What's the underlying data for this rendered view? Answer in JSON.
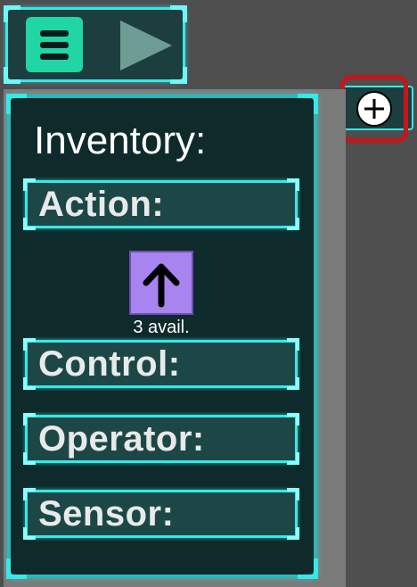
{
  "toolbar": {
    "menu_icon": "hamburger-menu-icon",
    "play_icon": "play-triangle-icon"
  },
  "add_button": {
    "icon": "plus-circle-icon",
    "highlight_color": "#c4161c"
  },
  "inventory": {
    "title": "Inventory:",
    "categories": [
      {
        "label": "Action:"
      },
      {
        "label": "Control:"
      },
      {
        "label": "Operator:"
      },
      {
        "label": "Sensor:"
      }
    ],
    "action_blocks": [
      {
        "icon": "up-arrow-icon",
        "count_text": "3 avail.",
        "color": "#a884f0"
      }
    ]
  },
  "colors": {
    "accent_cyan": "#37e8e8",
    "panel_bg": "#0f2a2a",
    "menu_button": "#1fd6a4",
    "background": "#4e4e4e"
  }
}
